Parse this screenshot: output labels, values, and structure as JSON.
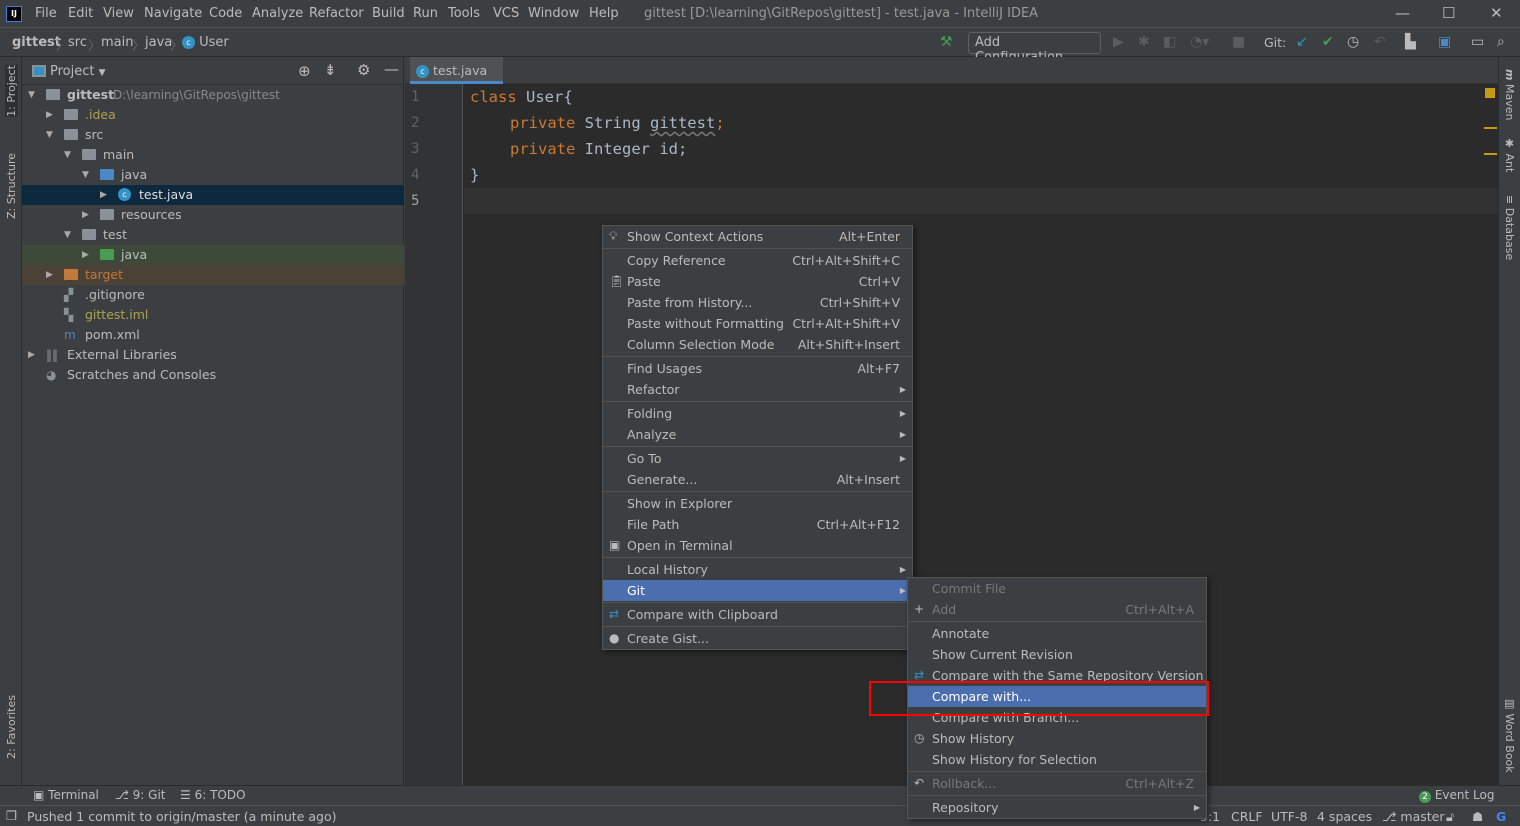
{
  "title_bar": {
    "menus": [
      "File",
      "Edit",
      "View",
      "Navigate",
      "Code",
      "Analyze",
      "Refactor",
      "Build",
      "Run",
      "Tools",
      "VCS",
      "Window",
      "Help"
    ],
    "window_title": "gittest [D:\\learning\\GitRepos\\gittest] - test.java - IntelliJ IDEA",
    "logo": "IJ"
  },
  "breadcrumb": [
    "gittest",
    "src",
    "main",
    "java",
    "User"
  ],
  "toolbar": {
    "add_configuration": "Add Configuration...",
    "git_label": "Git:"
  },
  "left_strip": {
    "project": "1: Project",
    "structure": "Z: Structure",
    "favorites": "2: Favorites"
  },
  "right_strip": {
    "maven": "Maven",
    "ant": "Ant",
    "database": "Database",
    "word_book": "Word Book"
  },
  "project_panel": {
    "title": "Project",
    "tree": [
      {
        "label": "gittest",
        "path": "D:\\learning\\GitRepos\\gittest",
        "depth": 0,
        "arrow": "down",
        "icon": "module-folder",
        "bold": true
      },
      {
        "label": ".idea",
        "depth": 1,
        "arrow": "right",
        "icon": "folder",
        "color": "#b0a050"
      },
      {
        "label": "src",
        "depth": 1,
        "arrow": "down",
        "icon": "folder"
      },
      {
        "label": "main",
        "depth": 2,
        "arrow": "down",
        "icon": "folder"
      },
      {
        "label": "java",
        "depth": 3,
        "arrow": "down",
        "icon": "source-folder"
      },
      {
        "label": "test.java",
        "depth": 4,
        "arrow": "right",
        "icon": "class",
        "selected": true
      },
      {
        "label": "resources",
        "depth": 3,
        "arrow": "right",
        "icon": "resources-folder"
      },
      {
        "label": "test",
        "depth": 2,
        "arrow": "down",
        "icon": "folder"
      },
      {
        "label": "java",
        "depth": 3,
        "arrow": "right",
        "icon": "test-folder",
        "highlight": "#3d4a3a"
      },
      {
        "label": "target",
        "depth": 1,
        "arrow": "right",
        "icon": "excluded-folder",
        "color": "#c07a3c",
        "highlight": "#4b4136"
      },
      {
        "label": ".gitignore",
        "depth": 1,
        "icon": "file"
      },
      {
        "label": "gittest.iml",
        "depth": 1,
        "icon": "iml-file",
        "color": "#b0a050"
      },
      {
        "label": "pom.xml",
        "depth": 1,
        "icon": "maven-file"
      },
      {
        "label": "External Libraries",
        "depth": 0,
        "arrow": "right",
        "icon": "libraries"
      },
      {
        "label": "Scratches and Consoles",
        "depth": 0,
        "icon": "scratches"
      }
    ]
  },
  "editor": {
    "tab": "test.java",
    "lines": [
      "1",
      "2",
      "3",
      "4",
      "5"
    ],
    "code": {
      "l1_kw": "class",
      "l1_rest": " User{",
      "l2_kw": "private",
      "l2_type": " String ",
      "l2_name": "gittest",
      "l2_end": ";",
      "l3_kw": "private",
      "l3_rest": " Integer id;",
      "l4": "}"
    }
  },
  "context_menu": [
    {
      "label": "Show Context Actions",
      "shortcut": "Alt+Enter",
      "icon": "bulb-icon"
    },
    {
      "sep": true
    },
    {
      "label": "Copy Reference",
      "shortcut": "Ctrl+Alt+Shift+C"
    },
    {
      "label": "Paste",
      "shortcut": "Ctrl+V",
      "icon": "paste-icon"
    },
    {
      "label": "Paste from History...",
      "shortcut": "Ctrl+Shift+V"
    },
    {
      "label": "Paste without Formatting",
      "shortcut": "Ctrl+Alt+Shift+V"
    },
    {
      "label": "Column Selection Mode",
      "shortcut": "Alt+Shift+Insert"
    },
    {
      "sep": true
    },
    {
      "label": "Find Usages",
      "shortcut": "Alt+F7"
    },
    {
      "label": "Refactor",
      "submenu": true
    },
    {
      "sep": true
    },
    {
      "label": "Folding",
      "submenu": true
    },
    {
      "label": "Analyze",
      "submenu": true
    },
    {
      "sep": true
    },
    {
      "label": "Go To",
      "submenu": true
    },
    {
      "label": "Generate...",
      "shortcut": "Alt+Insert"
    },
    {
      "sep": true
    },
    {
      "label": "Show in Explorer"
    },
    {
      "label": "File Path",
      "shortcut": "Ctrl+Alt+F12"
    },
    {
      "label": "Open in Terminal",
      "icon": "terminal-icon"
    },
    {
      "sep": true
    },
    {
      "label": "Local History",
      "submenu": true
    },
    {
      "label": "Git",
      "submenu": true,
      "selected": true
    },
    {
      "sep": true
    },
    {
      "label": "Compare with Clipboard",
      "icon": "compare-icon"
    },
    {
      "sep": true
    },
    {
      "label": "Create Gist...",
      "icon": "github-icon"
    }
  ],
  "git_submenu": [
    {
      "label": "Commit File",
      "disabled": true
    },
    {
      "label": "Add",
      "shortcut": "Ctrl+Alt+A",
      "disabled": true,
      "icon": "plus-icon"
    },
    {
      "sep": true
    },
    {
      "label": "Annotate"
    },
    {
      "label": "Show Current Revision"
    },
    {
      "label": "Compare with the Same Repository Version",
      "icon": "compare-icon"
    },
    {
      "label": "Compare with...",
      "selected": true
    },
    {
      "label": "Compare with Branch..."
    },
    {
      "label": "Show History",
      "icon": "clock-icon"
    },
    {
      "label": "Show History for Selection"
    },
    {
      "sep": true
    },
    {
      "label": "Rollback...",
      "shortcut": "Ctrl+Alt+Z",
      "disabled": true,
      "icon": "rollback-icon"
    },
    {
      "sep": true
    },
    {
      "label": "Repository",
      "submenu": true
    }
  ],
  "bottom_tools": {
    "terminal": "Terminal",
    "git": "9: Git",
    "todo": "6: TODO",
    "event_log": "Event Log",
    "event_count": "2"
  },
  "status_bar": {
    "message": "Pushed 1 commit to origin/master (a minute ago)",
    "position": "5:1",
    "line_sep": "CRLF",
    "encoding": "UTF-8",
    "indent": "4 spaces",
    "branch": "master"
  },
  "colors": {
    "selection": "#4b6eaf",
    "highlight_box": "#ff0000",
    "keyword": "#cc7832"
  }
}
